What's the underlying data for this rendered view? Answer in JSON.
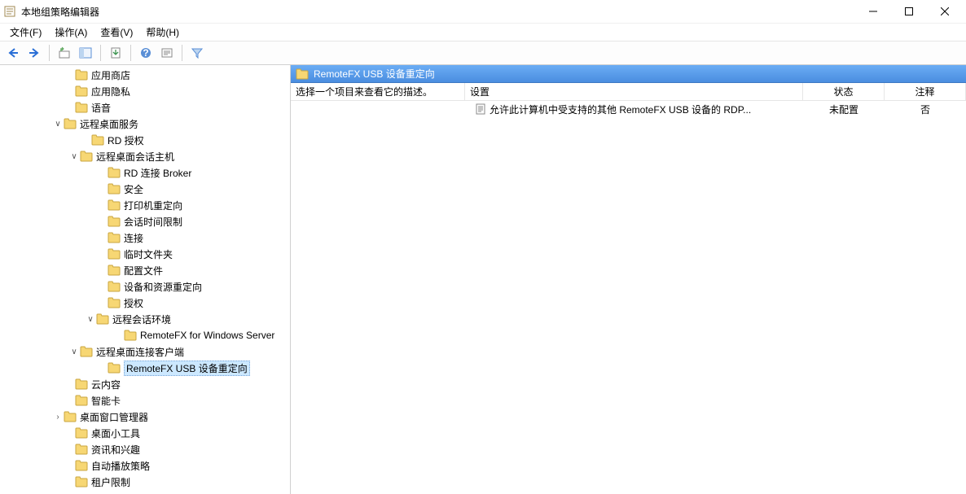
{
  "window": {
    "title": "本地组策略编辑器"
  },
  "menubar": {
    "file": "文件(F)",
    "action": "操作(A)",
    "view": "查看(V)",
    "help": "帮助(H)"
  },
  "tree": {
    "n0": "应用商店",
    "n1": "应用隐私",
    "n2": "语音",
    "n3": "远程桌面服务",
    "n4": "RD 授权",
    "n5": "远程桌面会话主机",
    "n6": "RD 连接 Broker",
    "n7": "安全",
    "n8": "打印机重定向",
    "n9": "会话时间限制",
    "n10": "连接",
    "n11": "临时文件夹",
    "n12": "配置文件",
    "n13": "设备和资源重定向",
    "n14": "授权",
    "n15": "远程会话环境",
    "n16": "RemoteFX for Windows Server",
    "n17": "远程桌面连接客户端",
    "n18": "RemoteFX USB 设备重定向",
    "n19": "云内容",
    "n20": "智能卡",
    "n21": "桌面窗口管理器",
    "n22": "桌面小工具",
    "n23": "资讯和兴趣",
    "n24": "自动播放策略",
    "n25": "租户限制"
  },
  "list": {
    "header_title": "RemoteFX USB 设备重定向",
    "desc_prompt": "选择一个项目来查看它的描述。",
    "col_setting": "设置",
    "col_state": "状态",
    "col_comment": "注释",
    "row0": {
      "setting": "允许此计算机中受支持的其他 RemoteFX USB 设备的 RDP...",
      "state": "未配置",
      "comment": "否"
    }
  }
}
